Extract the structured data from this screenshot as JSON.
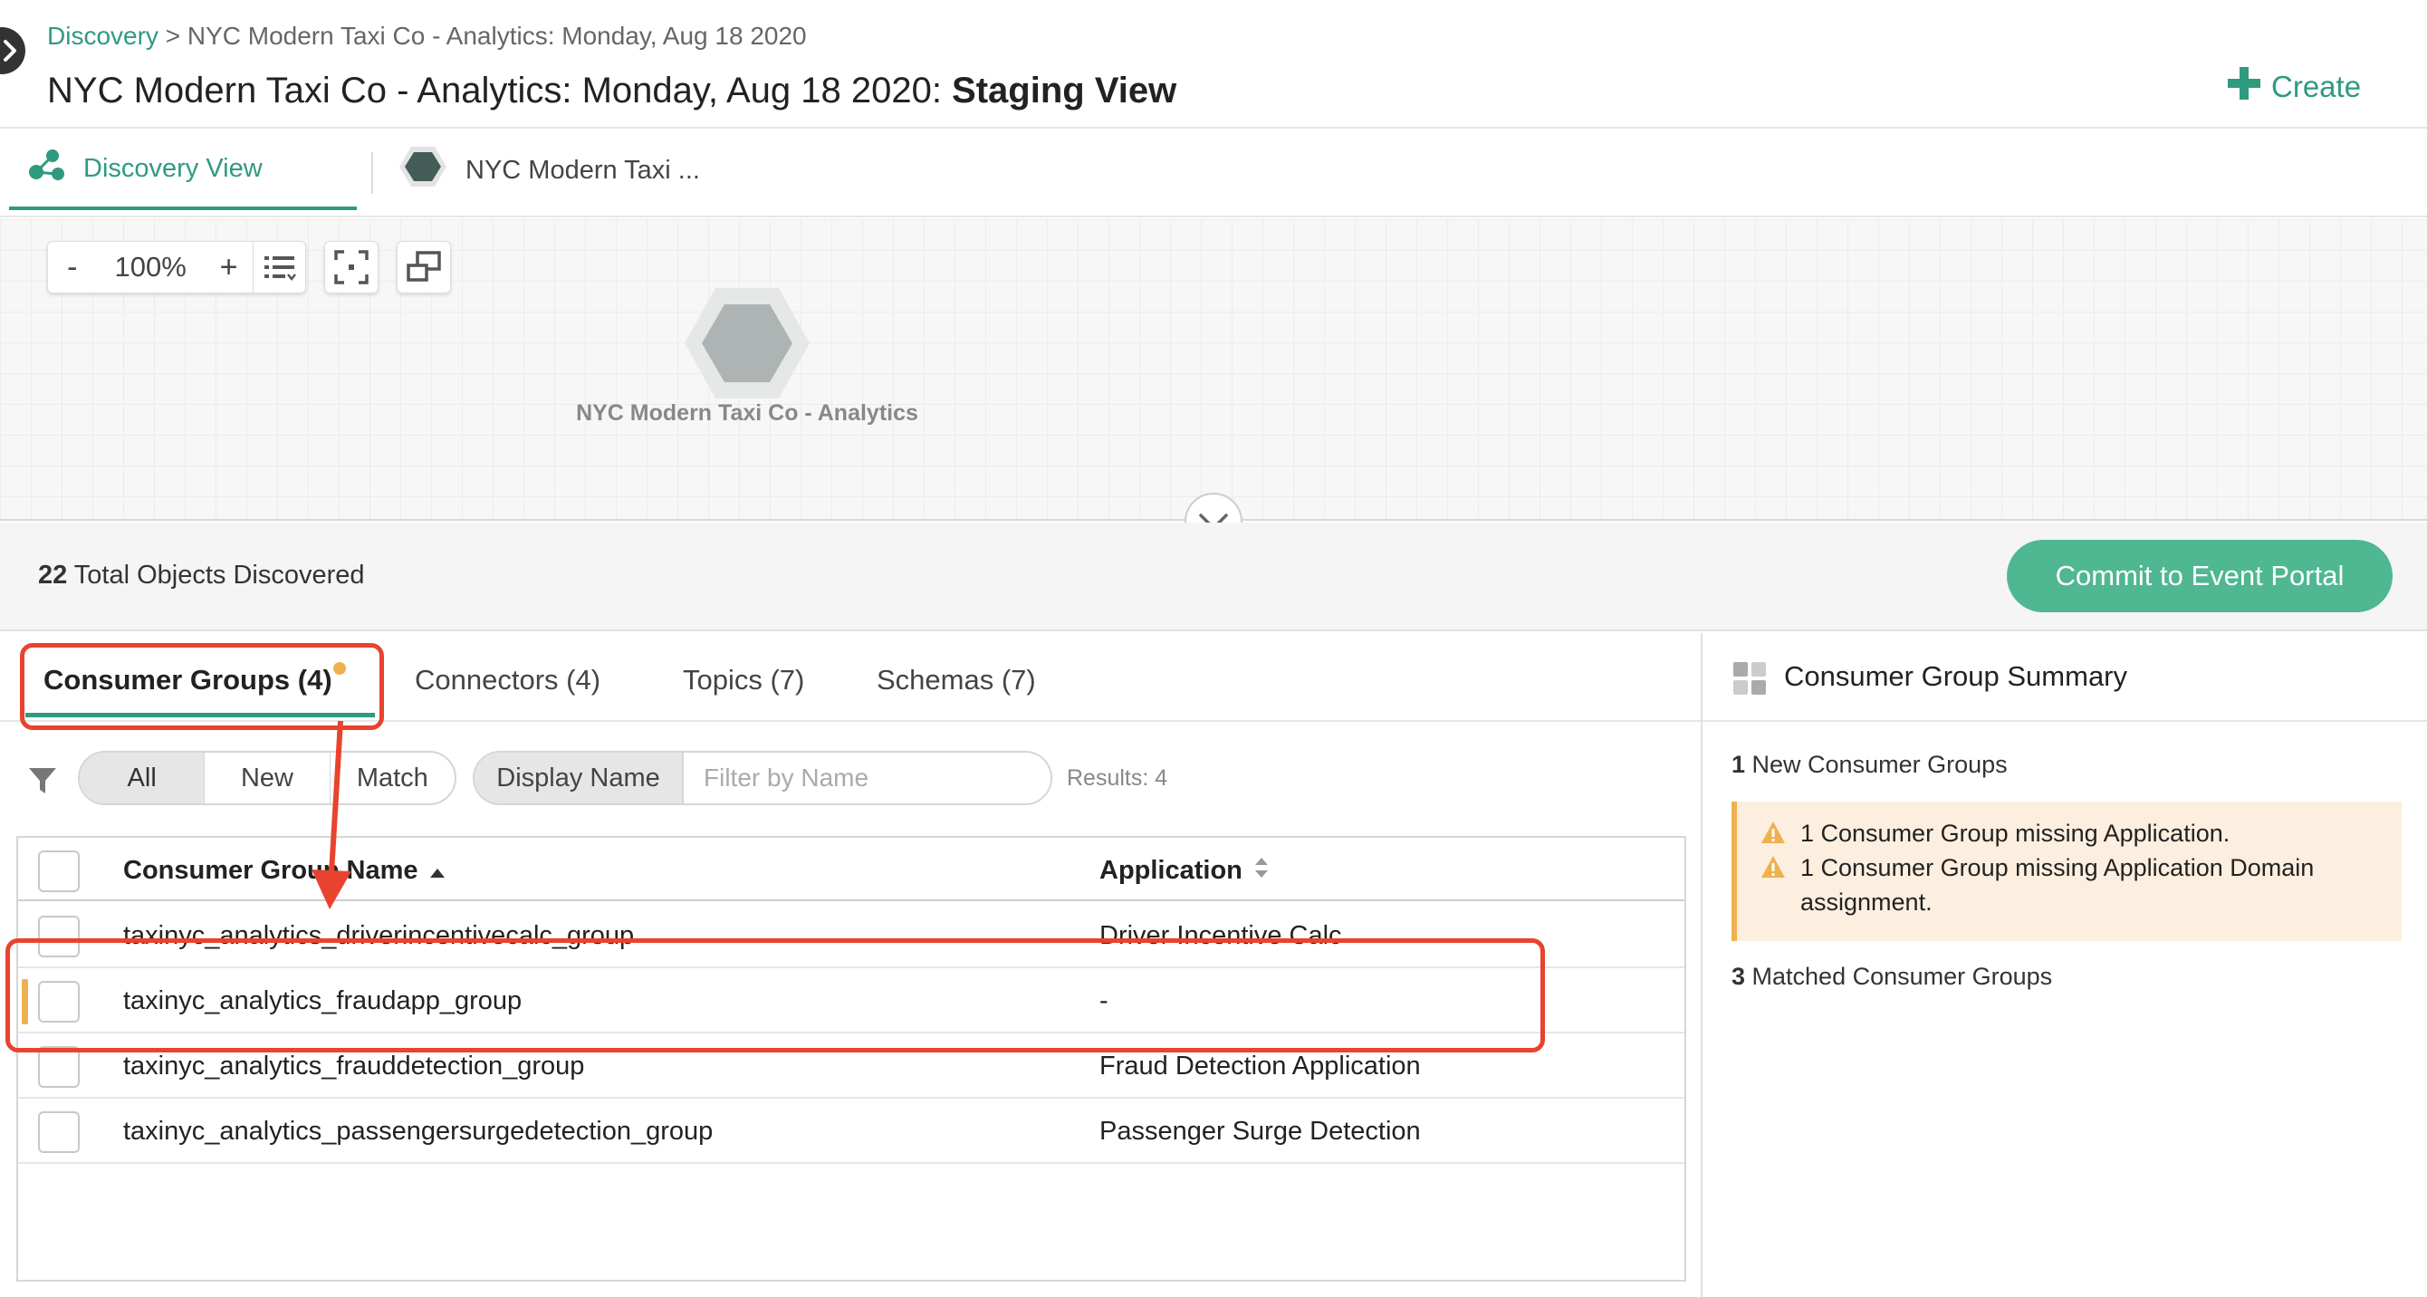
{
  "header": {
    "breadcrumb_link": "Discovery",
    "breadcrumb_sep": ">",
    "breadcrumb_current": "NYC Modern Taxi Co - Analytics: Monday, Aug 18 2020",
    "title_main": "NYC Modern Taxi Co - Analytics: Monday, Aug 18 2020: ",
    "title_bold": "Staging View",
    "create_label": "Create"
  },
  "view_tabs": [
    {
      "label": "Discovery View",
      "active": true
    },
    {
      "label": "NYC Modern Taxi ...",
      "active": false
    }
  ],
  "graph": {
    "zoom_minus": "-",
    "zoom_level": "100%",
    "zoom_plus": "+",
    "node_label": "NYC Modern Taxi Co - Analytics"
  },
  "summary": {
    "total_count": "22",
    "total_label": " Total Objects Discovered",
    "commit_label": "Commit to Event Portal"
  },
  "object_tabs": [
    {
      "label": "Consumer Groups (4)",
      "active": true,
      "has_dot": true
    },
    {
      "label": "Connectors (4)",
      "active": false
    },
    {
      "label": "Topics (7)",
      "active": false
    },
    {
      "label": "Schemas (7)",
      "active": false
    }
  ],
  "filters": {
    "segments": [
      "All",
      "New",
      "Match"
    ],
    "active_segment": "All",
    "field_label": "Display Name",
    "field_placeholder": "Filter by Name",
    "field_value": "",
    "results": "Results: 4"
  },
  "table": {
    "columns": [
      "Consumer Group Name",
      "Application"
    ],
    "rows": [
      {
        "name": "taxinyc_analytics_driverincentivecalc_group",
        "application": "Driver Incentive Calc",
        "flagged": false
      },
      {
        "name": "taxinyc_analytics_fraudapp_group",
        "application": "-",
        "flagged": true
      },
      {
        "name": "taxinyc_analytics_frauddetection_group",
        "application": "Fraud Detection Application",
        "flagged": false
      },
      {
        "name": "taxinyc_analytics_passengersurgedetection_group",
        "application": "Passenger Surge Detection",
        "flagged": false
      }
    ]
  },
  "side_panel": {
    "title": "Consumer Group Summary",
    "new_count": "1",
    "new_label": " New Consumer Groups",
    "warnings": [
      "1 Consumer Group missing Application.",
      "1 Consumer Group missing Application Domain assignment."
    ],
    "matched_count": "3",
    "matched_label": " Matched Consumer Groups"
  },
  "colors": {
    "accent": "#2f9a7f",
    "commit_button": "#4fb791",
    "warning": "#f0b050",
    "warning_bg": "#fcefdf",
    "annotation": "#e8432f"
  },
  "icons": [
    "collapse-icon",
    "plus-icon",
    "discovery-graph-icon",
    "hexagon-icon",
    "list-icon",
    "fit-screen-icon",
    "layout-icon",
    "chevron-down-icon",
    "filter-icon",
    "sort-asc-icon",
    "sort-icon",
    "summary-grid-icon",
    "warning-icon"
  ]
}
